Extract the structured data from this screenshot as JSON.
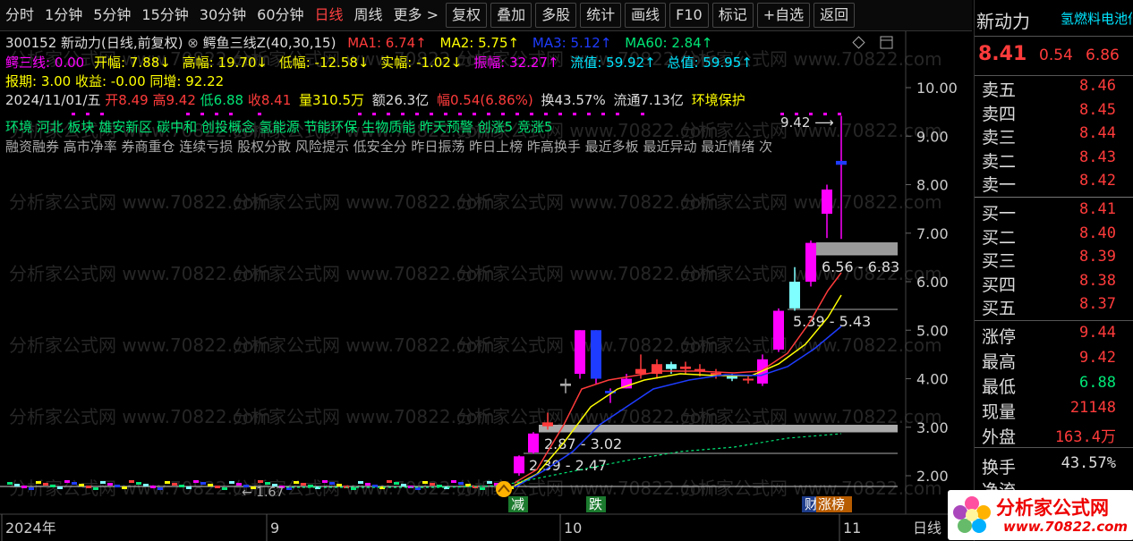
{
  "toolbar": {
    "periods": [
      "分时",
      "1分钟",
      "5分钟",
      "15分钟",
      "30分钟",
      "60分钟",
      "日线",
      "周线",
      "更多 >"
    ],
    "active_period": "日线",
    "buttons": [
      "复权",
      "叠加",
      "多股",
      "统计",
      "画线",
      "F10",
      "标记",
      "+自选",
      "返回"
    ]
  },
  "header": {
    "line1": {
      "code_name": "300152 新动力(日线,前复权)",
      "indicator": "鳄鱼三线Z(40,30,15)",
      "ma1": "MA1: 6.74↑",
      "ma2": "MA2: 5.75↑",
      "ma3": "MA3: 5.12↑",
      "ma60": "MA60: 2.84↑"
    },
    "line2": {
      "eshx": "鳄三线: 0.00",
      "kaifu": "开幅: 7.88↓",
      "gaofu": "高幅: 19.70↓",
      "difu": "低幅: -12.58↓",
      "shifu": "实幅: -1.02↓",
      "zhenfu": "振幅: 32.27↑",
      "liuzhi": "流值: 59.92↑",
      "zongzhi": "总值: 59.95↑"
    },
    "line3": "报期: 3.00 收益: -0.00 同增: 92.22",
    "line4": {
      "date": "2024/11/01/五",
      "open": "开8.49",
      "high": "高9.42",
      "low": "低6.88",
      "close": "收8.41",
      "vol": "量310.5万",
      "amount": "额26.3亿",
      "range": "幅0.54(6.86%)",
      "turnover": "换43.57%",
      "float": "流通7.13亿",
      "concept": "环境保护"
    },
    "tags_green": "环境 河北 板块 雄安新区 碳中和 创投概念 氢能源 节能环保 生物质能 昨天预警 创涨5 竞涨5",
    "tags_gray": "融资融券 高市净率 券商重仓 连续亏损 股权分散 风险提示 低安全分 昨日振荡 昨日上榜 昨高换手 最近多板 最近异动 最近情绪 次"
  },
  "axis": {
    "y_ticks": [
      "10.00",
      "9.00",
      "8.00",
      "7.00",
      "6.00",
      "5.00",
      "4.00",
      "3.00",
      "2.00"
    ],
    "x_labels": [
      "2024年",
      "9",
      "10",
      "11"
    ],
    "period_label": "日线"
  },
  "annotations": {
    "peak": "9.42",
    "zone1": "6.56 - 6.83",
    "zone2": "5.39 - 5.43",
    "zone3": "2.87 - 3.02",
    "zone4": "2.39 - 2.47",
    "low_label": "1.67",
    "sig_jian": "减",
    "sig_die": "跌",
    "sig_cai": "财",
    "sig_zhangbang": "涨榜"
  },
  "quote": {
    "name": "新动力",
    "sector": "氢燃料电池倍",
    "price": "8.41",
    "change": "0.54",
    "pct": "6.86",
    "asks": [
      {
        "label": "卖五",
        "price": "8.46"
      },
      {
        "label": "卖四",
        "price": "8.45"
      },
      {
        "label": "卖三",
        "price": "8.44"
      },
      {
        "label": "卖二",
        "price": "8.43"
      },
      {
        "label": "卖一",
        "price": "8.42"
      }
    ],
    "bids": [
      {
        "label": "买一",
        "price": "8.41"
      },
      {
        "label": "买二",
        "price": "8.40"
      },
      {
        "label": "买三",
        "price": "8.39"
      },
      {
        "label": "买四",
        "price": "8.38"
      },
      {
        "label": "买五",
        "price": "8.37"
      }
    ],
    "stats": [
      {
        "label": "涨停",
        "value": "9.44"
      },
      {
        "label": "最高",
        "value": "9.42"
      },
      {
        "label": "最低",
        "value": "6.88"
      },
      {
        "label": "现量",
        "value": "21148"
      },
      {
        "label": "外盘",
        "value": "163.4万"
      }
    ],
    "turnover_label": "换手",
    "turnover_value": "43.57%",
    "cut_label": "净流"
  },
  "logo": {
    "text": "分析家公式网",
    "url": "www.70822.com"
  },
  "watermark": "分析家公式网 www.70822.com",
  "colors": {
    "up": "#ff3b3b",
    "down": "#00e676",
    "magenta": "#ff00ff",
    "cyan": "#7fffff",
    "blue": "#1e3cff",
    "yellow": "#ffff00"
  }
}
